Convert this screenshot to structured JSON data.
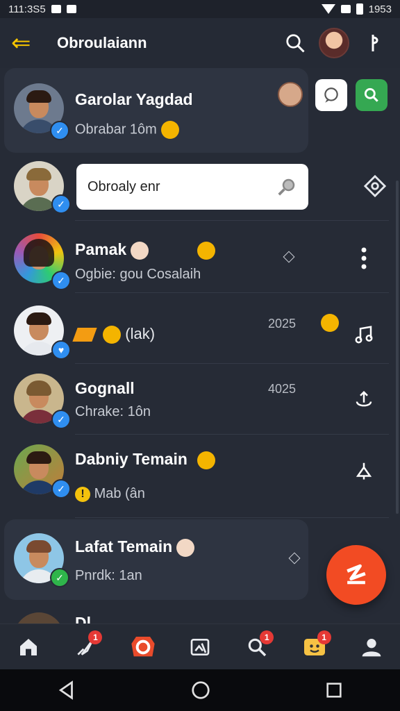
{
  "status": {
    "time": "111:3S5",
    "right_time": "1953"
  },
  "header": {
    "title": "Obroulaiann"
  },
  "search": {
    "placeholder": "Obroaly enr"
  },
  "chats": [
    {
      "name": "Garolar Yagdad",
      "preview": "Obrabar 1ôm",
      "time": ""
    },
    {
      "name": "",
      "preview": "",
      "time": ""
    },
    {
      "name": "Pamak",
      "preview": "Ogbie: gou Cosalaih",
      "time": ""
    },
    {
      "name": "",
      "preview": "(lak)",
      "time": "2025"
    },
    {
      "name": "Gognall",
      "preview": "Chrake: 1ôn",
      "time": "4025"
    },
    {
      "name": "Dabniy Temain",
      "preview": "Mab (ân",
      "time": ""
    },
    {
      "name": "Lafat Temain",
      "preview": "Pnrdk: 1an",
      "time": ""
    },
    {
      "name": "Dl...",
      "preview": "",
      "time": ""
    }
  ],
  "nav": {
    "badges": {
      "explore": "1",
      "search": "1",
      "messages": "1"
    }
  },
  "colors": {
    "accent": "#f24b23",
    "verified": "#2f8ef0",
    "online": "#2fb54b"
  }
}
